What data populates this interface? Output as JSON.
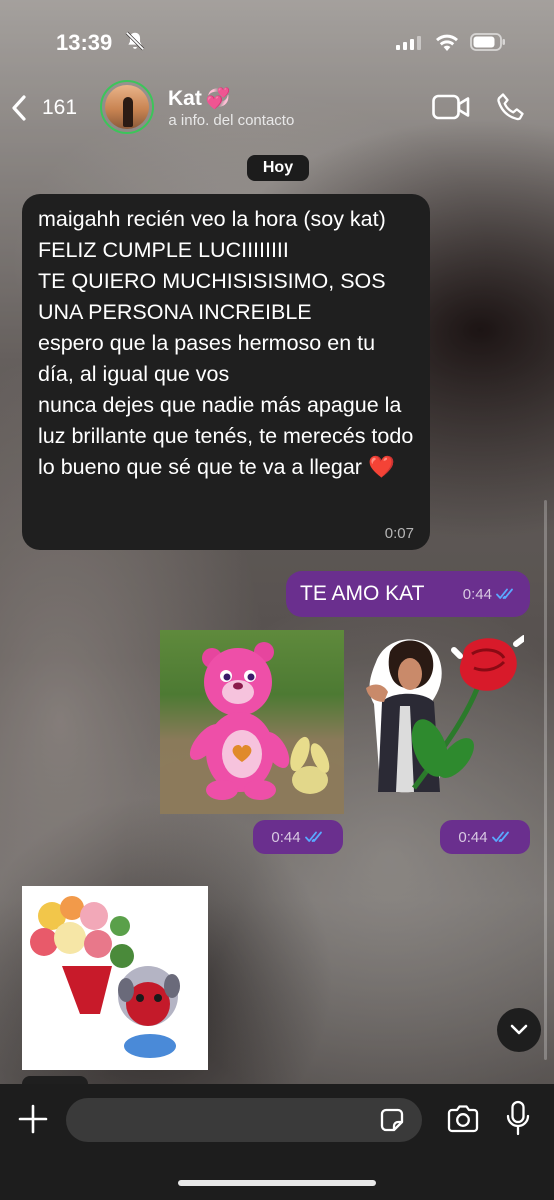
{
  "status_bar": {
    "time": "13:39"
  },
  "header": {
    "back_count": "161",
    "contact_name": "Kat",
    "contact_subtitle": "Toca para ver la info. del contacto"
  },
  "chat": {
    "date_label": "Hoy",
    "incoming": {
      "lines": [
        "maigahh recién veo la hora (soy kat)",
        "FELIZ CUMPLE LUCIIIIIIII",
        "TE QUIERO MUCHISISISIMO, SOS UNA PERSONA INCREIBLE",
        "espero que la pases hermoso en tu día, al igual que vos",
        "nunca dejes que nadie más apague la luz brillante que tenés, te merecés todo lo bueno que sé que te va a llegar"
      ],
      "emoji": "❤️",
      "time": "0:07"
    },
    "outgoing": {
      "text": "TE AMO KAT",
      "time": "0:44"
    },
    "sticker_times": [
      "0:44",
      "0:44"
    ]
  },
  "composer": {
    "placeholder": ""
  },
  "colors": {
    "outgoing_bubble": "#6a2f8e",
    "incoming_bubble": "#1f1f1f",
    "read_ticks": "#5aa9ff",
    "avatar_ring": "#3cc55a"
  }
}
